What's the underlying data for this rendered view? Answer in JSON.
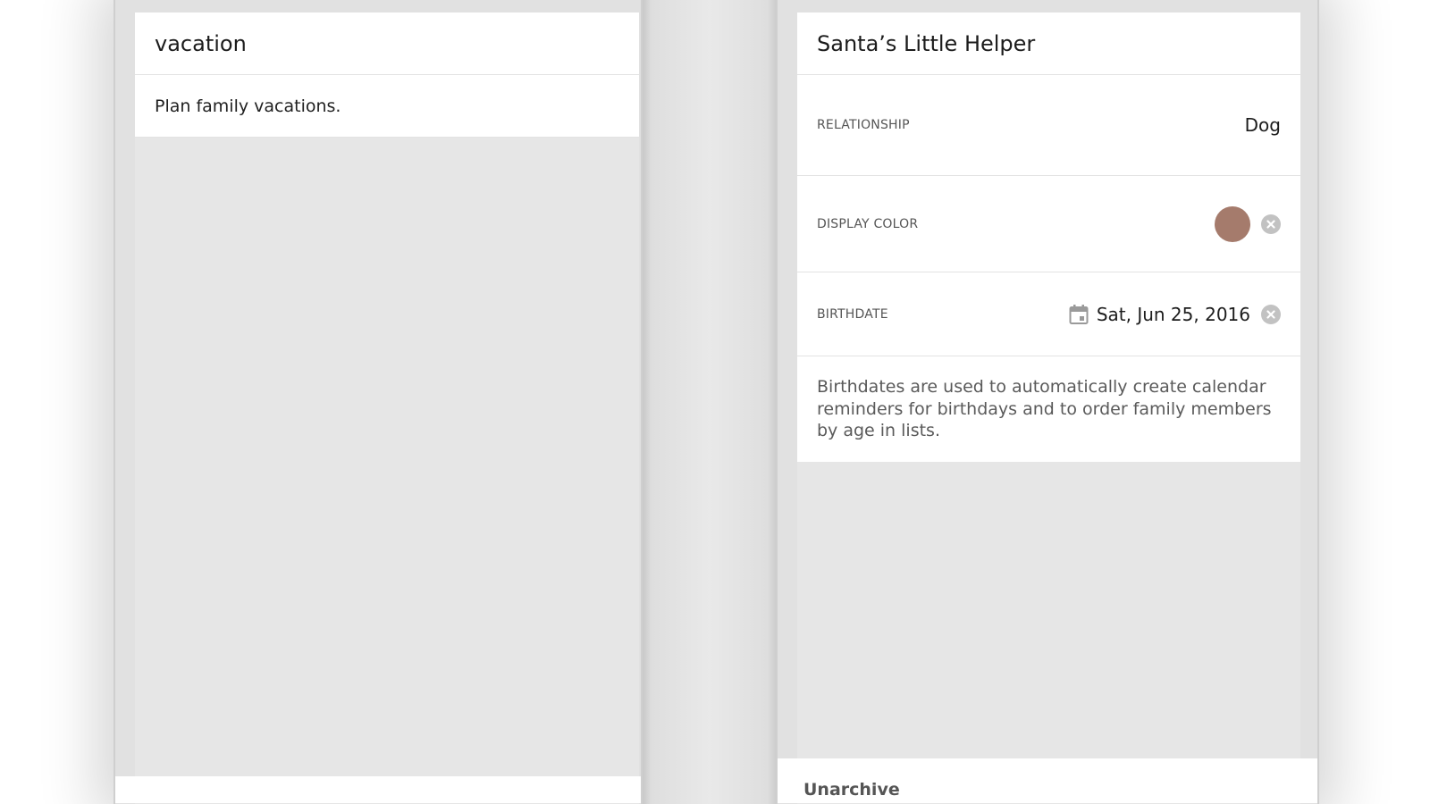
{
  "left_panel": {
    "title": "vacation",
    "description": "Plan family vacations."
  },
  "right_panel": {
    "name": "Santa’s Little Helper",
    "relationship": {
      "label": "RELATIONSHIP",
      "value": "Dog"
    },
    "display_color": {
      "label": "DISPLAY COLOR",
      "color": "#a57b6c",
      "clear_icon": "clear-circle-icon"
    },
    "birthdate": {
      "label": "BIRTHDATE",
      "value": "Sat, Jun 25, 2016",
      "icon": "calendar-icon",
      "clear_icon": "clear-circle-icon"
    },
    "note": "Birthdates are used to automatically create calendar reminders for birthdays and to order family members by age in lists.",
    "unarchive_label": "Unarchive"
  },
  "colors": {
    "background": "#e1e1e1",
    "card": "#ffffff",
    "swatch": "#a57b6c",
    "clear_button": "#c2c2c2"
  }
}
